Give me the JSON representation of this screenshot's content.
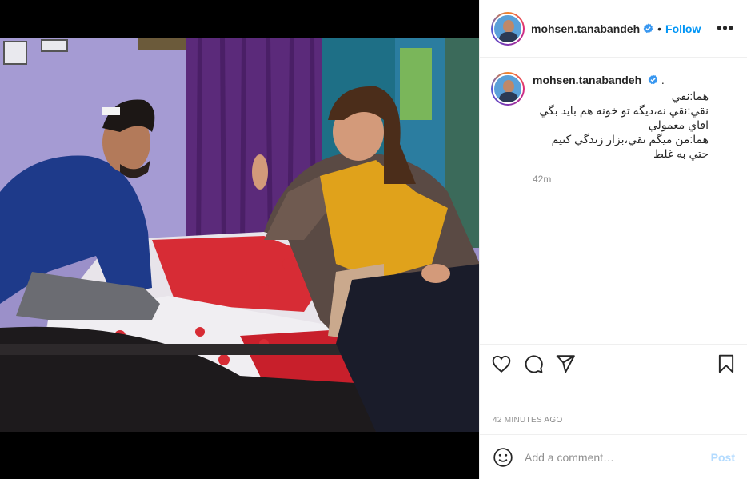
{
  "post": {
    "username": "mohsen.tanabandeh",
    "separator": "•",
    "follow_label": "Follow",
    "more_label": "•••",
    "caption_trail": ".",
    "caption_lines": [
      "هما:نقي",
      "نقي:نقي نه،ديگه تو خونه هم بايد بگي اقاي معمولي",
      "هما:من ميگم نقي،بزار زندگي كنيم حتي به غلط"
    ],
    "caption_age": "42m",
    "posted_time": "42 MINUTES AGO"
  },
  "actions": {
    "like_icon": "heart-icon",
    "comment_icon": "comment-icon",
    "share_icon": "paper-plane-icon",
    "save_icon": "bookmark-icon"
  },
  "comment_box": {
    "emoji_icon": "smiley-icon",
    "placeholder": "Add a comment…",
    "post_label": "Post"
  },
  "colors": {
    "accent": "#0095f6",
    "post_disabled": "#b3dbff",
    "verified": "#3897f0",
    "muted": "#8e8e8e",
    "border": "#efefef"
  }
}
